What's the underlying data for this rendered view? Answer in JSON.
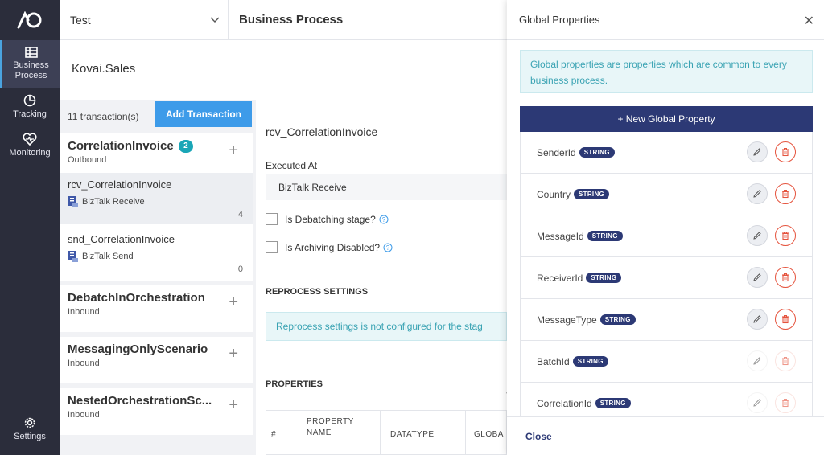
{
  "nav": {
    "items": [
      {
        "label_line1": "Business",
        "label_line2": "Process",
        "icon": "list-icon",
        "active": true
      },
      {
        "label": "Tracking",
        "icon": "pie-chart-icon"
      },
      {
        "label": "Monitoring",
        "icon": "heart-pulse-icon"
      }
    ],
    "settings_label": "Settings"
  },
  "topbar": {
    "environment": "Test",
    "page_title": "Business Process"
  },
  "app_header": {
    "name": "Kovai.Sales"
  },
  "transactions": {
    "count_text": "11 transaction(s)",
    "add_button": "Add Transaction",
    "groups": [
      {
        "title": "CorrelationInvoice",
        "badge": "2",
        "direction": "Outbound",
        "items": [
          {
            "name": "rcv_CorrelationInvoice",
            "type": "BizTalk Receive",
            "count": "4",
            "selected": true
          },
          {
            "name": "snd_CorrelationInvoice",
            "type": "BizTalk Send",
            "count": "0"
          }
        ]
      },
      {
        "title": "DebatchInOrchestration",
        "direction": "Inbound"
      },
      {
        "title": "MessagingOnlyScenario",
        "direction": "Inbound"
      },
      {
        "title": "NestedOrchestrationSc...",
        "direction": "Inbound"
      }
    ]
  },
  "main": {
    "step_title": "rcv_CorrelationInvoice",
    "executed_at_label": "Executed At",
    "executed_at_value": "BizTalk Receive",
    "debatching_label": "Is Debatching stage?",
    "archiving_label": "Is Archiving Disabled?",
    "reprocess_title": "REPROCESS SETTINGS",
    "reprocess_info": "Reprocess settings is not configured for the stag",
    "properties_title": "PROPERTIES",
    "table_headers": {
      "num": "#",
      "name_line1": "PROPERTY",
      "name_line2": "NAME",
      "datatype": "DATATYPE",
      "global": "GLOBA"
    }
  },
  "drawer": {
    "title": "Global Properties",
    "description": "Global properties are properties which are common to every business process.",
    "new_button": "+ New Global Property",
    "properties": [
      {
        "name": "SenderId",
        "type": "STRING"
      },
      {
        "name": "Country",
        "type": "STRING"
      },
      {
        "name": "MessageId",
        "type": "STRING"
      },
      {
        "name": "ReceiverId",
        "type": "STRING"
      },
      {
        "name": "MessageType",
        "type": "STRING"
      },
      {
        "name": "BatchId",
        "type": "STRING",
        "disabled": true
      },
      {
        "name": "CorrelationId",
        "type": "STRING",
        "disabled": true
      }
    ],
    "close_label": "Close"
  },
  "colors": {
    "nav_bg": "#2b2d3b",
    "accent_blue": "#3d9be9",
    "navy": "#2c3975",
    "teal_badge": "#1aa6b7",
    "delete_red": "#e5533d"
  }
}
